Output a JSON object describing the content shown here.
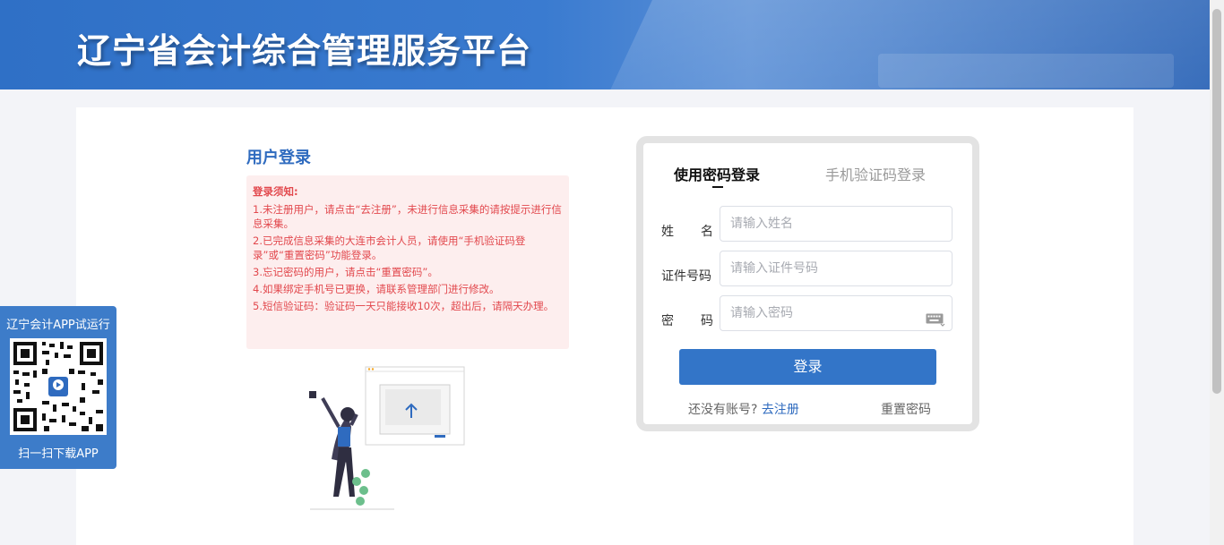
{
  "header": {
    "title": "辽宁省会计综合管理服务平台"
  },
  "login_section": {
    "title": "用户登录",
    "notice": {
      "title": "登录须知:",
      "items": [
        "1.未注册用户，请点击“去注册”，未进行信息采集的请按提示进行信息采集。",
        "2.已完成信息采集的大连市会计人员，请使用“手机验证码登录”或“重置密码”功能登录。",
        "3.忘记密码的用户，请点击“重置密码”。",
        "4.如果绑定手机号已更换，请联系管理部门进行修改。",
        "5.短信验证码：验证码一天只能接收10次，超出后，请隔天办理。"
      ]
    }
  },
  "form": {
    "tabs": {
      "password": "使用密码登录",
      "sms": "手机验证码登录"
    },
    "name_label_chars": [
      "姓",
      "名"
    ],
    "name_placeholder": "请输入姓名",
    "id_label": "证件号码",
    "id_placeholder": "请输入证件号码",
    "pwd_label_chars": [
      "密",
      "码"
    ],
    "pwd_placeholder": "请输入密码",
    "login_button": "登录",
    "no_account": "还没有账号?",
    "register_link": "去注册",
    "reset_link": "重置密码"
  },
  "app_promo": {
    "title": "辽宁会计APP试运行",
    "subtitle": "扫一扫下载APP"
  },
  "colors": {
    "primary": "#3375c8",
    "notice_bg": "#fdeeee",
    "notice_text": "#e2484d",
    "header": "#3a7bd0"
  },
  "icons": {
    "keyboard": "keyboard-icon",
    "upload": "upload-arrow-icon",
    "qr": "qr-code-icon"
  }
}
